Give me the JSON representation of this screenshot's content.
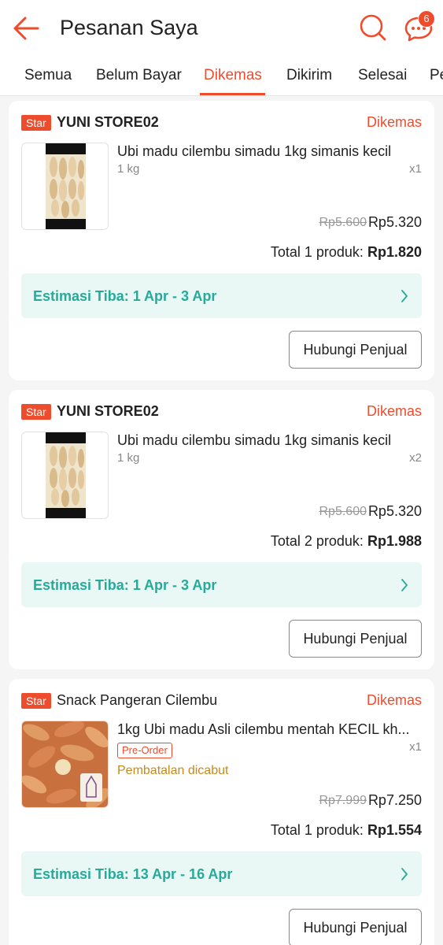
{
  "header": {
    "title": "Pesanan Saya",
    "back_icon": "arrow-left-icon",
    "search_icon": "search-icon",
    "chat_icon": "chat-icon",
    "chat_badge": "6",
    "accent_color": "#ee4d2d"
  },
  "tabs": [
    {
      "label": "Semua"
    },
    {
      "label": "Belum Bayar"
    },
    {
      "label": "Dikemas",
      "active": true
    },
    {
      "label": "Dikirim"
    },
    {
      "label": "Selesai"
    },
    {
      "label": "Pe"
    }
  ],
  "orders": [
    {
      "badge": "Star",
      "shop": "YUNI STORE02",
      "status": "Dikemas",
      "product": "Ubi madu cilembu simadu 1kg simanis kecil",
      "variant": "1 kg",
      "qty": "x1",
      "old_price": "Rp5.600",
      "price": "Rp5.320",
      "total_label": "Total 1 produk:",
      "total_value": "Rp1.820",
      "eta": "Estimasi Tiba: 1 Apr - 3 Apr",
      "button": "Hubungi Penjual"
    },
    {
      "badge": "Star",
      "shop": "YUNI STORE02",
      "status": "Dikemas",
      "product": "Ubi madu cilembu simadu 1kg simanis kecil",
      "variant": "1 kg",
      "qty": "x2",
      "old_price": "Rp5.600",
      "price": "Rp5.320",
      "total_label": "Total 2 produk:",
      "total_value": "Rp1.988",
      "eta": "Estimasi Tiba: 1 Apr - 3 Apr",
      "button": "Hubungi Penjual"
    },
    {
      "badge": "Star",
      "shop": "Snack Pangeran Cilembu",
      "status": "Dikemas",
      "product": "1kg Ubi madu Asli cilembu mentah KECIL kh...",
      "preorder": "Pre-Order",
      "cancel_note": "Pembatalan dicabut",
      "qty": "x1",
      "old_price": "Rp7.999",
      "price": "Rp7.250",
      "total_label": "Total 1 produk:",
      "total_value": "Rp1.554",
      "eta": "Estimasi Tiba: 13 Apr - 16 Apr",
      "button": "Hubungi Penjual"
    }
  ],
  "eta_color": "#26aa99",
  "eta_bg": "#e9f8f4"
}
